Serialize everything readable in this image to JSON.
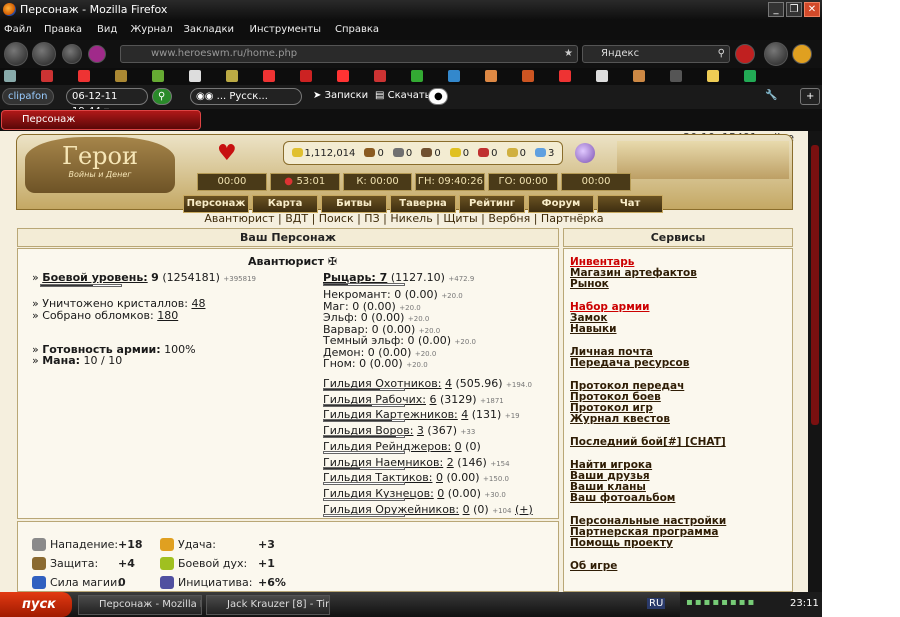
{
  "window": {
    "title": "Персонаж - Mozilla Firefox"
  },
  "menu": [
    "Файл",
    "Правка",
    "Вид",
    "Журнал",
    "Закладки",
    "Инструменты",
    "Справка"
  ],
  "nav": {
    "url": "www.heroeswm.ru/home.php",
    "search_placeholder": "Яндекс"
  },
  "toolbar3": {
    "date": "06-12-11 19:44",
    "media": "... Русск...",
    "notes": "Записки",
    "download": "Скачать"
  },
  "tab": {
    "label": "Персонаж"
  },
  "page": {
    "online": "20:10, 15491 online",
    "logo": {
      "title": "Герои",
      "subtitle": "Войны и Денег"
    },
    "resources": [
      "1,112,014",
      "0",
      "0",
      "0",
      "0",
      "0",
      "0",
      "3"
    ],
    "timers": [
      "00:00",
      "53:01",
      "К: 00:00",
      "ГН: 09:40:26",
      "ГО: 00:00",
      "00:00"
    ],
    "nav": [
      "Персонаж",
      "Карта",
      "Битвы",
      "Таверна",
      "Рейтинг",
      "Форум",
      "Чат"
    ],
    "sublinks": "Авантюрист | ВДТ | Поиск | ПЗ | Никель | Щиты | Вербня | Партнёрка",
    "char": {
      "head": "Ваш Персонаж",
      "class": "Авантюрист",
      "combat_label": "Боевой уровень:",
      "combat_value": "9",
      "combat_exp": "(1254181)",
      "combat_extra": "+395819",
      "combat_progress": 0.65,
      "crystals_label": "Уничтожено кристаллов:",
      "crystals": "48",
      "shards_label": "Собрано обломков:",
      "shards": "180",
      "army_label": "Готовность армии:",
      "army": "100%",
      "mana_label": "Мана:",
      "mana": "10 / 10"
    },
    "factions": {
      "main_label": "Рыцарь: 7",
      "main_value": "(1127.10)",
      "main_extra": "+472.9",
      "list": [
        {
          "t": "Некромант: 0 (0.00)",
          "x": "+20.0"
        },
        {
          "t": "Маг: 0 (0.00)",
          "x": "+20.0"
        },
        {
          "t": "Эльф: 0 (0.00)",
          "x": "+20.0"
        },
        {
          "t": "Варвар: 0 (0.00)",
          "x": "+20.0"
        },
        {
          "t": "Темный эльф: 0 (0.00)",
          "x": "+20.0"
        },
        {
          "t": "Демон: 0 (0.00)",
          "x": "+20.0"
        },
        {
          "t": "Гном: 0 (0.00)",
          "x": "+20.0"
        }
      ]
    },
    "guilds": [
      {
        "name": "Гильдия Охотников:",
        "val": "4",
        "rest": "(505.96)",
        "x": "+194.0",
        "p": 0.7
      },
      {
        "name": "Гильдия Рабочих:",
        "val": "6",
        "rest": "(3129)",
        "x": "+1871",
        "p": 0.6
      },
      {
        "name": "Гильдия Картежников:",
        "val": "4",
        "rest": "(131)",
        "x": "+19",
        "p": 0.85
      },
      {
        "name": "Гильдия Воров:",
        "val": "3",
        "rest": "(367)",
        "x": "+33",
        "p": 0.9
      },
      {
        "name": "Гильдия Рейнджеров:",
        "val": "0",
        "rest": "(0)",
        "x": "",
        "p": 0
      },
      {
        "name": "Гильдия Наемников:",
        "val": "2",
        "rest": "(146)",
        "x": "+154",
        "p": 0.45
      },
      {
        "name": "Гильдия Тактиков:",
        "val": "0",
        "rest": "(0.00)",
        "x": "+150.0",
        "p": 0
      },
      {
        "name": "Гильдия Кузнецов:",
        "val": "0",
        "rest": "(0.00)",
        "x": "+30.0",
        "p": 0
      },
      {
        "name": "Гильдия Оружейников:",
        "val": "0",
        "rest": "(0)",
        "x": "+104",
        "extra": "(+)",
        "p": 0
      }
    ],
    "services": {
      "head": "Сервисы",
      "groups": [
        [
          {
            "t": "Инвентарь",
            "red": true
          },
          {
            "t": "Магазин артефактов"
          },
          {
            "t": "Рынок"
          }
        ],
        [
          {
            "t": "Набор армии",
            "red": true
          },
          {
            "t": "Замок"
          },
          {
            "t": "Навыки"
          }
        ],
        [
          {
            "t": "Личная почта"
          },
          {
            "t": "Передача ресурсов"
          }
        ],
        [
          {
            "t": "Протокол передач"
          },
          {
            "t": "Протокол боев"
          },
          {
            "t": "Протокол игр"
          },
          {
            "t": "Журнал квестов"
          }
        ],
        [
          {
            "t": "Последний бой[#] [CHAT]"
          }
        ],
        [
          {
            "t": "Найти игрока"
          },
          {
            "t": "Ваши друзья"
          },
          {
            "t": "Ваши кланы"
          },
          {
            "t": "Ваш фотоальбом"
          }
        ],
        [
          {
            "t": "Персональные настройки"
          },
          {
            "t": "Партнерская программа"
          },
          {
            "t": "Помощь проекту"
          }
        ],
        [
          {
            "t": "Об игре"
          }
        ]
      ]
    },
    "stats": [
      {
        "l": "Нападение:",
        "v": "+18",
        "icon": "sword-icon",
        "c": "#8a8a8a"
      },
      {
        "l": "Удача:",
        "v": "+3",
        "icon": "rainbow-icon",
        "c": "#e0a020"
      },
      {
        "l": "Защита:",
        "v": "+4",
        "icon": "shield-icon",
        "c": "#8a6a30"
      },
      {
        "l": "Боевой дух:",
        "v": "+1",
        "icon": "morale-icon",
        "c": "#a0c020"
      },
      {
        "l": "Сила магии:",
        "v": "0",
        "icon": "wand-icon",
        "c": "#3060c0"
      },
      {
        "l": "Инициатива:",
        "v": "+6%",
        "icon": "initiative-icon",
        "c": "#5050a0"
      }
    ]
  },
  "taskbar": {
    "start": "пуск",
    "tasks": [
      "Персонаж - Mozilla Fi...",
      "Jack Krauzer [8] - Tim..."
    ],
    "lang": "RU",
    "clock": "23:11"
  }
}
